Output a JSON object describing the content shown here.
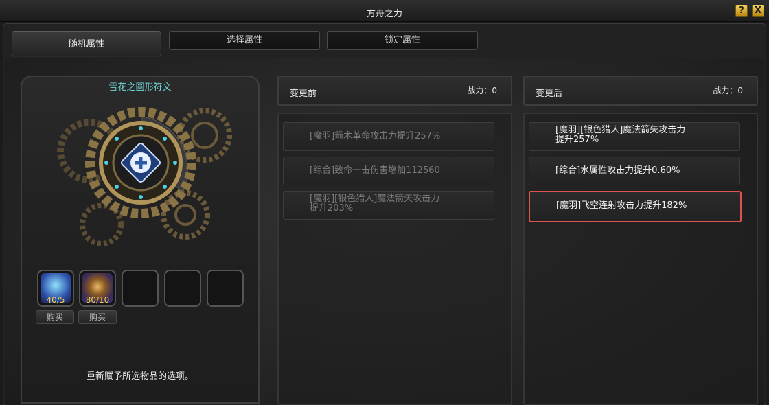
{
  "window": {
    "title": "方舟之力",
    "help_label": "?",
    "close_label": "X"
  },
  "tabs": [
    {
      "label": "随机属性",
      "active": true
    },
    {
      "label": "选择属性",
      "active": false
    },
    {
      "label": "锁定属性",
      "active": false
    }
  ],
  "left_panel": {
    "rune_name": "雪花之圆形符文",
    "slots": [
      {
        "count": "40/5",
        "icon": "crystal-shard-icon"
      },
      {
        "count": "80/10",
        "icon": "amulet-icon"
      },
      {
        "count": ""
      },
      {
        "count": ""
      },
      {
        "count": ""
      }
    ],
    "buy_label": "购买",
    "help_text": "重新赋予所选物品的选项。"
  },
  "before": {
    "header": "变更前",
    "power": "战力：0",
    "options": [
      {
        "text": "[魔羽]箭术革命攻击力提升257%"
      },
      {
        "text": "[综合]致命一击伤害增加112560"
      },
      {
        "line1": "[魔羽][银色猎人]魔法箭矢攻击力",
        "line2": "提升203%"
      }
    ]
  },
  "after": {
    "header": "变更后",
    "power": "战力：0",
    "options": [
      {
        "line1": "[魔羽][银色猎人]魔法箭矢攻击力",
        "line2": "提升257%"
      },
      {
        "text": "[综合]水属性攻击力提升0.60%"
      },
      {
        "text": "[魔羽]飞空连射攻击力提升182%"
      }
    ]
  }
}
